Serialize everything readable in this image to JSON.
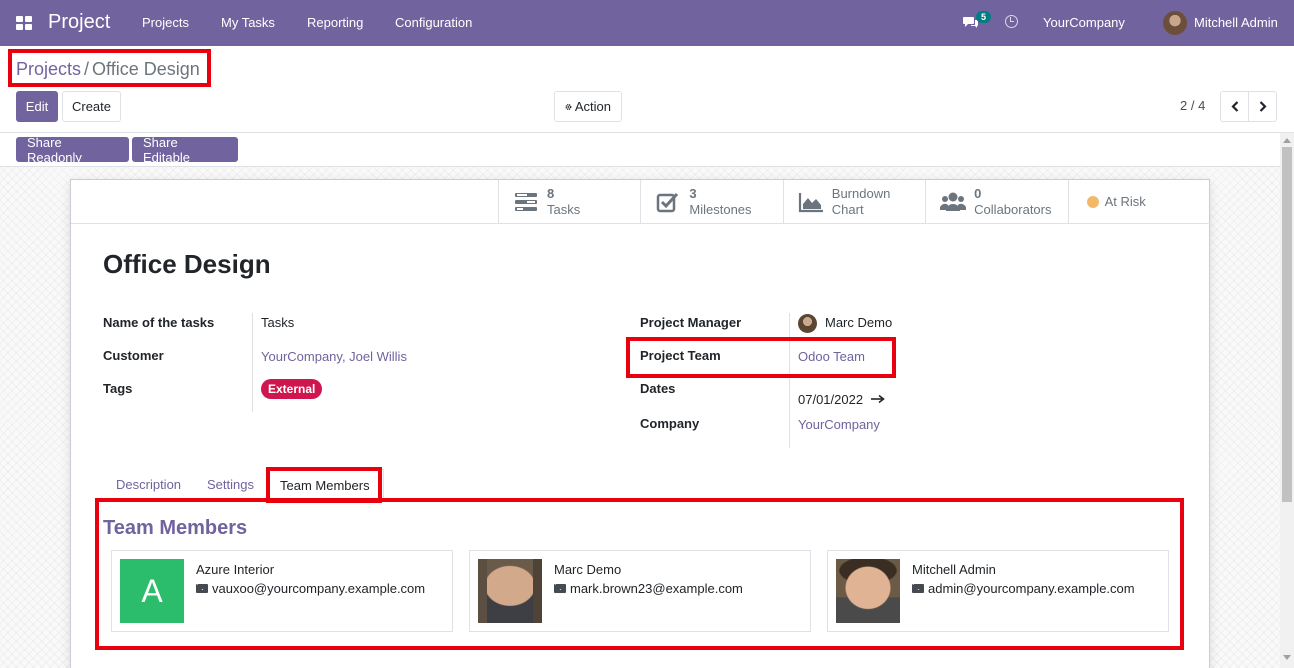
{
  "navbar": {
    "app_name": "Project",
    "menu": [
      "Projects",
      "My Tasks",
      "Reporting",
      "Configuration"
    ],
    "chat_count": "5",
    "company": "YourCompany",
    "user": "Mitchell Admin",
    "bg_color": "#71639e"
  },
  "breadcrumb": {
    "parent": "Projects",
    "separator": "/",
    "current": "Office Design"
  },
  "control": {
    "edit_label": "Edit",
    "create_label": "Create",
    "action_label": "Action",
    "pager": "2 / 4"
  },
  "statusbar": {
    "share_readonly": "Share Readonly",
    "share_editable": "Share Editable"
  },
  "smart_buttons": [
    {
      "value": "8",
      "label": "Tasks",
      "icon": "tasks-icon"
    },
    {
      "value": "3",
      "label": "Milestones",
      "icon": "check-square-icon"
    },
    {
      "value": "Burndown",
      "label": "Chart",
      "icon": "area-chart-icon"
    },
    {
      "value": "0",
      "label": "Collaborators",
      "icon": "users-icon"
    },
    {
      "value": "",
      "label": "At Risk",
      "icon": "status-dot-icon"
    }
  ],
  "form": {
    "title": "Office Design",
    "left": {
      "task_name_label": "Name of the tasks",
      "task_name_value": "Tasks",
      "customer_label": "Customer",
      "customer_value": "YourCompany, Joel Willis",
      "tags_label": "Tags",
      "tag": "External"
    },
    "right": {
      "manager_label": "Project Manager",
      "manager_value": "Marc Demo",
      "team_label": "Project Team",
      "team_value": "Odoo Team",
      "dates_label": "Dates",
      "date_start": "07/01/2022",
      "company_label": "Company",
      "company_value": "YourCompany"
    }
  },
  "tabs": [
    "Description",
    "Settings",
    "Team Members"
  ],
  "team": {
    "title": "Team Members",
    "members": [
      {
        "name": "Azure Interior",
        "email": "vauxoo@yourcompany.example.com",
        "initial": "A"
      },
      {
        "name": "Marc Demo",
        "email": "mark.brown23@example.com"
      },
      {
        "name": "Mitchell Admin",
        "email": "admin@yourcompany.example.com"
      }
    ]
  },
  "colors": {
    "primary": "#71639e",
    "highlight": "#e8000e",
    "tag": "#d0164f",
    "at_risk": "#f0ad4e"
  }
}
